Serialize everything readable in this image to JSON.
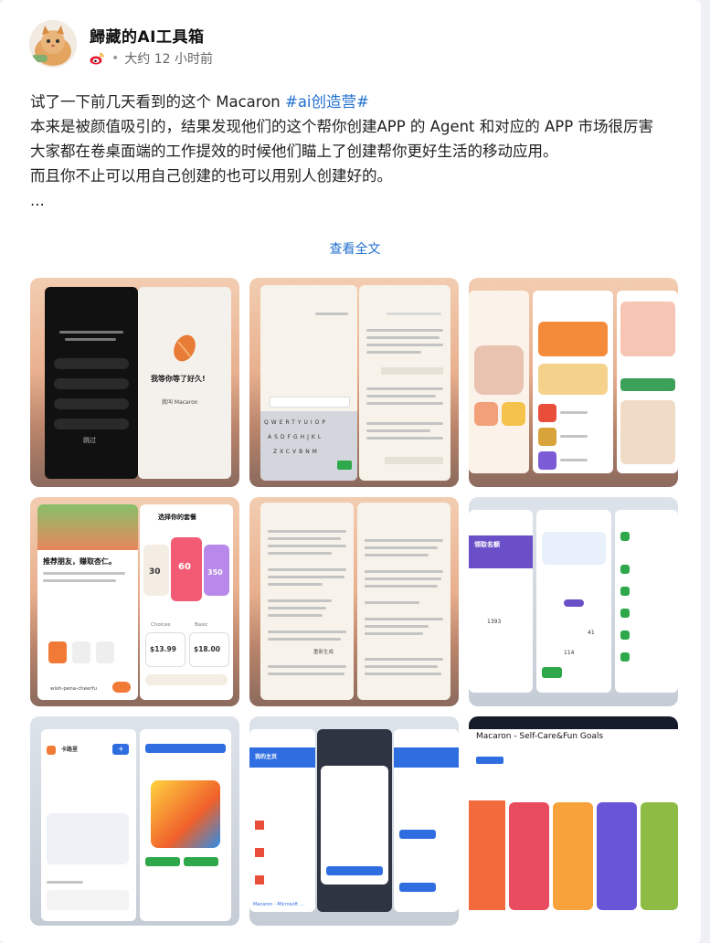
{
  "post": {
    "author": "歸藏的AI工具箱",
    "time": "大约 12 小时前",
    "lines": [
      {
        "text": "试了一下前几天看到的这个 Macaron ",
        "tag": "#ai创造营#"
      },
      {
        "text": "本来是被颜值吸引的，结果发现他们的这个帮你创建APP 的 Agent 和对应的 APP 市场很厉害"
      },
      {
        "text": "大家都在卷桌面端的工作提效的时候他们瞄上了创建帮你更好生活的移动应用。"
      },
      {
        "text": "而且你不止可以用自己创建的也可以用别人创建好的。"
      },
      {
        "text": "..."
      }
    ],
    "view_full": "查看全文"
  },
  "images": {
    "img1": {
      "welcome": "我等你等了好久!",
      "btn": "我叫 Macaron",
      "skip": "跳过"
    },
    "img4": {
      "title": "选择你的套餐",
      "headline": "推荐朋友，赚取杏仁。",
      "prices": [
        "$13.99",
        "$18.00"
      ],
      "amounts": [
        "30",
        "60",
        "350"
      ],
      "handle": "wish-pena-cheerfu",
      "plan_tabs": [
        "Choices",
        "Basic"
      ]
    },
    "img5": {
      "reply": "重新生成"
    },
    "img6": {
      "purple_title": "领取名额",
      "nums": [
        "1393",
        "41",
        "114"
      ]
    },
    "img7": {
      "title": "卡路里",
      "btn": "+"
    },
    "img8": {
      "section": "我的主页",
      "link": "Macaron - Microsoft ..."
    },
    "img9": {
      "title": "Macaron - Self-Care&Fun Goals"
    }
  },
  "colors": {
    "link": "#1f6fcf",
    "text": "#222222",
    "meta": "#666666",
    "weibo": "#e6162d"
  }
}
